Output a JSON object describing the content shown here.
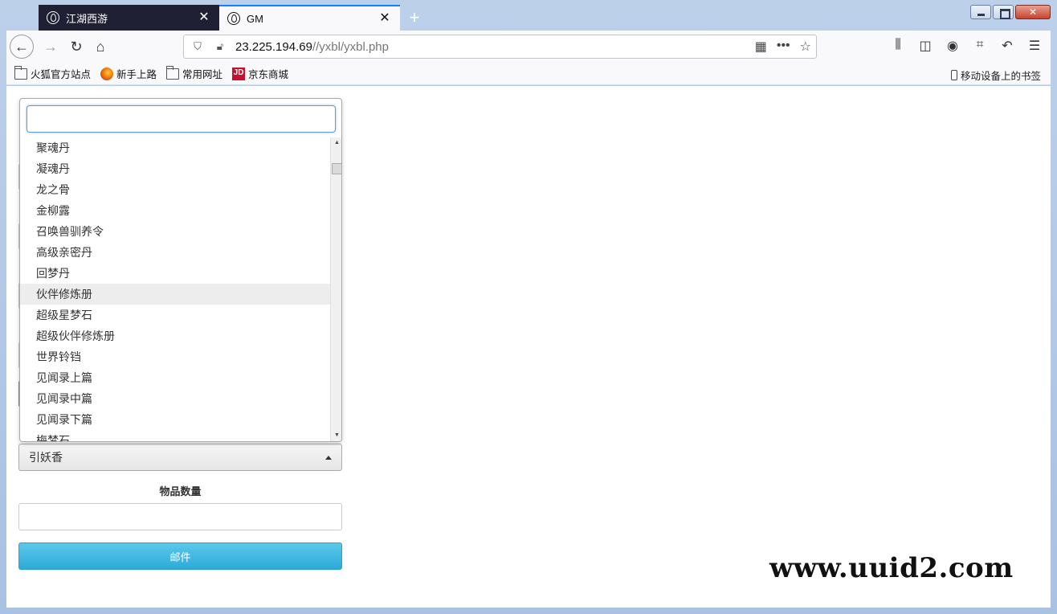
{
  "tabs": [
    {
      "title": "江湖西游"
    },
    {
      "title": "GM"
    }
  ],
  "urlbar": {
    "host": "23.225.194.69",
    "path": "//yxbl/yxbl.php"
  },
  "bookmarks": [
    {
      "label": "火狐官方站点"
    },
    {
      "label": "新手上路"
    },
    {
      "label": "常用网址"
    },
    {
      "label": "京东商城"
    }
  ],
  "mobile_bookmarks": "移动设备上的书签",
  "dropdown": {
    "search_value": "",
    "items": [
      {
        "label": "聚魂丹"
      },
      {
        "label": "凝魂丹"
      },
      {
        "label": "龙之骨"
      },
      {
        "label": "金柳露"
      },
      {
        "label": "召唤兽驯养令"
      },
      {
        "label": "高级亲密丹"
      },
      {
        "label": "回梦丹"
      },
      {
        "label": "伙伴修炼册"
      },
      {
        "label": "超级星梦石"
      },
      {
        "label": "超级伙伴修炼册"
      },
      {
        "label": "世界铃铛"
      },
      {
        "label": "见闻录上篇"
      },
      {
        "label": "见闻录中篇"
      },
      {
        "label": "见闻录下篇"
      },
      {
        "label": "梅梦石"
      }
    ],
    "highlighted_index": 7
  },
  "select": {
    "selected": "引妖香"
  },
  "form": {
    "quantity_label": "物品数量",
    "quantity_value": "",
    "submit_label": "邮件"
  },
  "watermark": "www.uuid2.com",
  "colors": {
    "accent": "#0a84ff",
    "button": "#3bb4de"
  }
}
